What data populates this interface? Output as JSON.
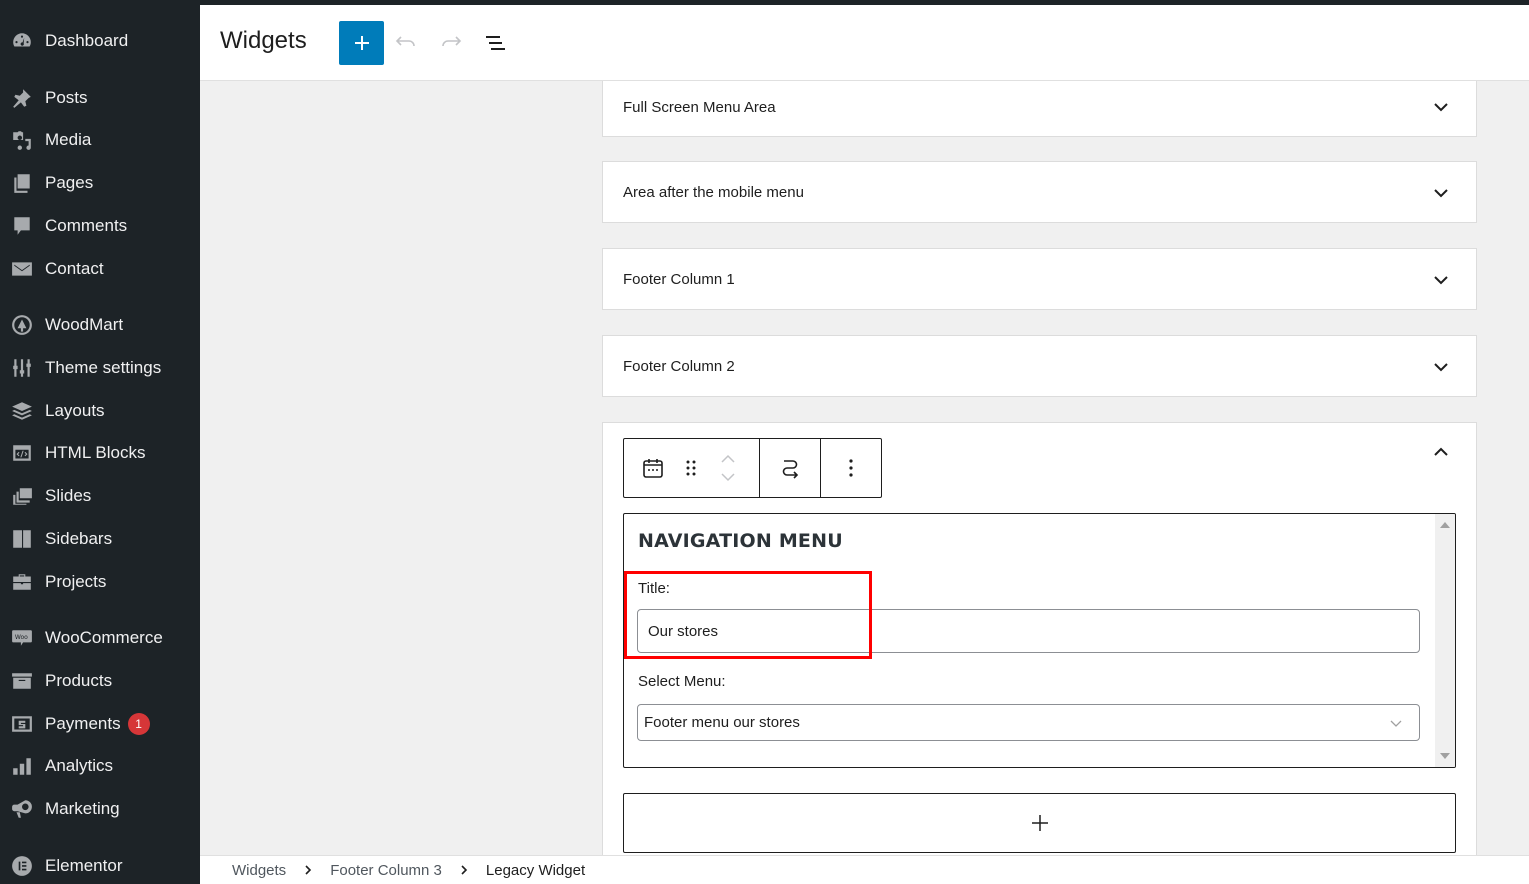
{
  "sidebar": {
    "items": [
      {
        "label": "Dashboard",
        "icon": "dashboard-icon"
      },
      {
        "label": "Posts",
        "icon": "pin-icon"
      },
      {
        "label": "Media",
        "icon": "media-icon"
      },
      {
        "label": "Pages",
        "icon": "pages-icon"
      },
      {
        "label": "Comments",
        "icon": "comment-icon"
      },
      {
        "label": "Contact",
        "icon": "envelope-icon"
      },
      {
        "label": "WoodMart",
        "icon": "woodmart-icon"
      },
      {
        "label": "Theme settings",
        "icon": "sliders-icon"
      },
      {
        "label": "Layouts",
        "icon": "layers-icon"
      },
      {
        "label": "HTML Blocks",
        "icon": "code-block-icon"
      },
      {
        "label": "Slides",
        "icon": "slides-icon"
      },
      {
        "label": "Sidebars",
        "icon": "sidebar-icon"
      },
      {
        "label": "Projects",
        "icon": "briefcase-icon"
      },
      {
        "label": "WooCommerce",
        "icon": "woo-icon"
      },
      {
        "label": "Products",
        "icon": "archive-box-icon"
      },
      {
        "label": "Payments",
        "icon": "dollar-icon",
        "badge": "1"
      },
      {
        "label": "Analytics",
        "icon": "bar-chart-icon"
      },
      {
        "label": "Marketing",
        "icon": "megaphone-icon"
      },
      {
        "label": "Elementor",
        "icon": "elementor-icon"
      }
    ]
  },
  "header": {
    "title": "Widgets",
    "add_block_label": "Add block",
    "undo_label": "Undo",
    "redo_label": "Redo",
    "list_view_label": "List view"
  },
  "areas": [
    {
      "title": "Full Screen Menu Area",
      "expanded": false
    },
    {
      "title": "Area after the mobile menu",
      "expanded": false
    },
    {
      "title": "Footer Column 1",
      "expanded": false
    },
    {
      "title": "Footer Column 2",
      "expanded": false
    }
  ],
  "widget": {
    "heading": "NAVIGATION MENU",
    "title_label": "Title:",
    "title_value": "Our stores",
    "select_label": "Select Menu:",
    "select_value": "Footer menu our stores"
  },
  "breadcrumb": [
    "Widgets",
    "Footer Column 3",
    "Legacy Widget"
  ],
  "colors": {
    "accent": "#007cba",
    "sidebar_bg": "#1d2327",
    "badge": "#d63638",
    "highlight": "#ff0000"
  }
}
